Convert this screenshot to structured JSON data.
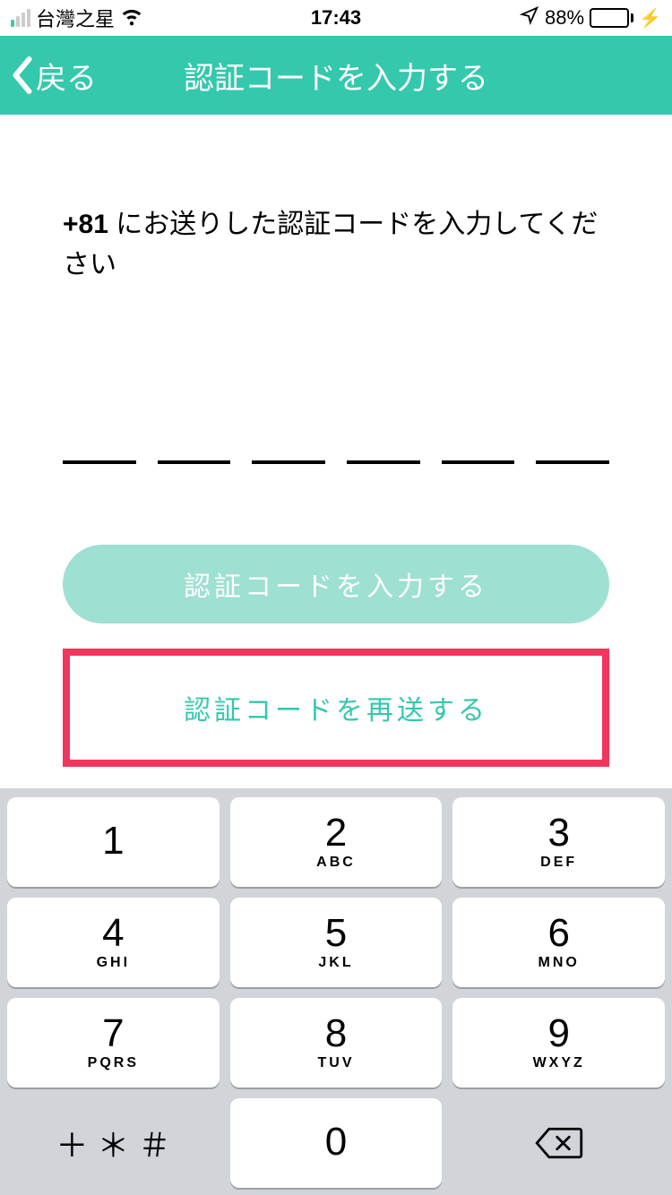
{
  "status": {
    "carrier": "台灣之星",
    "time": "17:43",
    "battery_percent": "88%"
  },
  "nav": {
    "back_label": "戻る",
    "title": "認証コードを入力する"
  },
  "instruction": {
    "prefix": "+81",
    "rest": " にお送りした認証コードを入力してください"
  },
  "code_length": 6,
  "buttons": {
    "submit_label": "認証コードを入力する",
    "resend_label": "認証コードを再送する"
  },
  "keyboard": {
    "keys": [
      {
        "num": "1",
        "letters": ""
      },
      {
        "num": "2",
        "letters": "ABC"
      },
      {
        "num": "3",
        "letters": "DEF"
      },
      {
        "num": "4",
        "letters": "GHI"
      },
      {
        "num": "5",
        "letters": "JKL"
      },
      {
        "num": "6",
        "letters": "MNO"
      },
      {
        "num": "7",
        "letters": "PQRS"
      },
      {
        "num": "8",
        "letters": "TUV"
      },
      {
        "num": "9",
        "letters": "WXYZ"
      },
      {
        "num": "0",
        "letters": ""
      }
    ],
    "symbol_key": "＋ ＊ ＃"
  }
}
